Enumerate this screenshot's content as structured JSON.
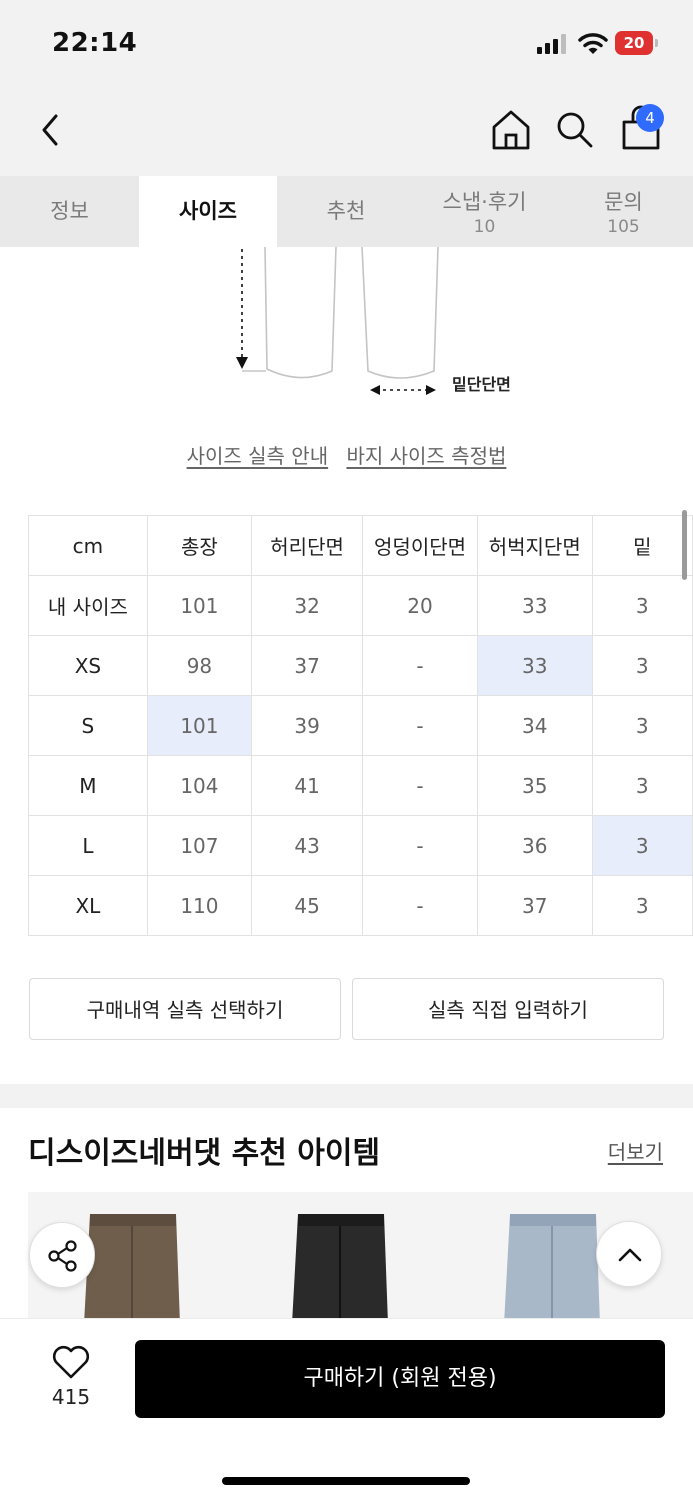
{
  "status_bar": {
    "time": "22:14",
    "battery": "20"
  },
  "header": {
    "cart_count": "4"
  },
  "tabs": [
    {
      "label": "정보",
      "count": ""
    },
    {
      "label": "사이즈",
      "count": ""
    },
    {
      "label": "추천",
      "count": ""
    },
    {
      "label": "스냅·후기",
      "count": "10"
    },
    {
      "label": "문의",
      "count": "105"
    }
  ],
  "active_tab": "사이즈",
  "illustration": {
    "hem_label": "밑단단면"
  },
  "guides": {
    "measure_guide": "사이즈 실측 안내",
    "pants_method": "바지 사이즈 측정법"
  },
  "size_table": {
    "headers": [
      "cm",
      "총장",
      "허리단면",
      "엉덩이단면",
      "허벅지단면",
      "밑"
    ],
    "rows": [
      {
        "label": "내 사이즈",
        "values": [
          "101",
          "32",
          "20",
          "33",
          "3"
        ]
      },
      {
        "label": "XS",
        "values": [
          "98",
          "37",
          "-",
          "33",
          "3"
        ]
      },
      {
        "label": "S",
        "values": [
          "101",
          "39",
          "-",
          "34",
          "3"
        ]
      },
      {
        "label": "M",
        "values": [
          "104",
          "41",
          "-",
          "35",
          "3"
        ]
      },
      {
        "label": "L",
        "values": [
          "107",
          "43",
          "-",
          "36",
          "3"
        ]
      },
      {
        "label": "XL",
        "values": [
          "110",
          "45",
          "-",
          "37",
          "3"
        ]
      }
    ]
  },
  "actions": {
    "select_history": "구매내역 실측 선택하기",
    "direct_input": "실측 직접 입력하기"
  },
  "recommend": {
    "title": "디스이즈네버댓 추천 아이템",
    "more": "더보기"
  },
  "bottom": {
    "likes": "415",
    "buy_label": "구매하기 (회원 전용)"
  },
  "colors": {
    "accent_badge": "#2f6bff",
    "highlight_cell": "#e7edfb",
    "battery_low": "#e03131",
    "buy_button": "#000000"
  }
}
